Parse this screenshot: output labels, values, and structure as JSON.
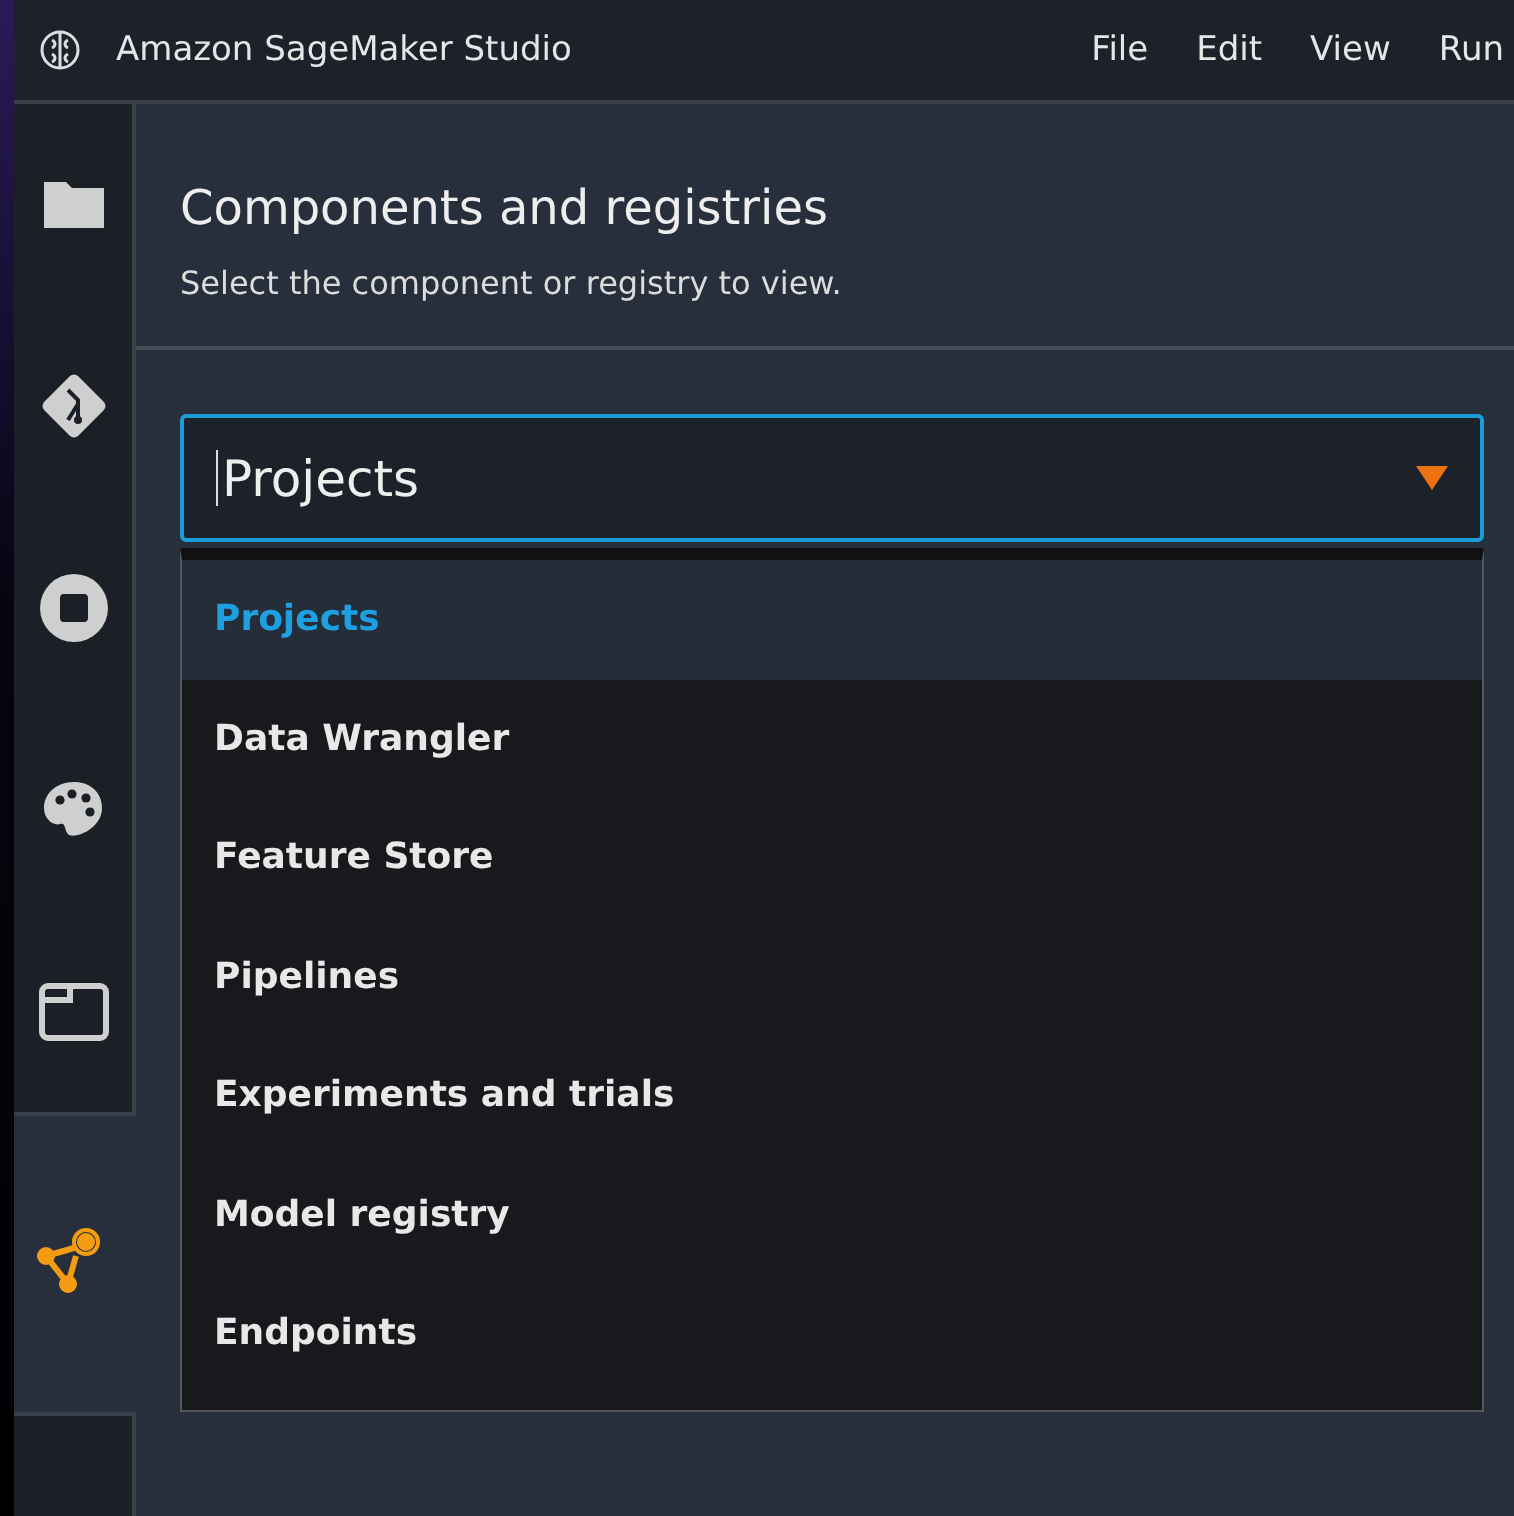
{
  "window": {
    "title": "Amazon SageMaker Studio"
  },
  "menu": [
    "File",
    "Edit",
    "View",
    "Run"
  ],
  "sidebar": {
    "items": [
      {
        "kind": "folder",
        "selected": false
      },
      {
        "kind": "git",
        "selected": false
      },
      {
        "kind": "stop",
        "selected": false
      },
      {
        "kind": "palette",
        "selected": false
      },
      {
        "kind": "tab",
        "selected": false
      },
      {
        "kind": "graph",
        "selected": true
      }
    ]
  },
  "panel": {
    "title": "Components and registries",
    "subtitle": "Select the component or registry to view.",
    "select": {
      "value": "Projects",
      "expanded": true,
      "options": [
        {
          "label": "Projects",
          "selected": true
        },
        {
          "label": "Data Wrangler",
          "selected": false
        },
        {
          "label": "Feature Store",
          "selected": false
        },
        {
          "label": "Pipelines",
          "selected": false
        },
        {
          "label": "Experiments and trials",
          "selected": false
        },
        {
          "label": "Model registry",
          "selected": false
        },
        {
          "label": "Endpoints",
          "selected": false
        }
      ]
    }
  }
}
